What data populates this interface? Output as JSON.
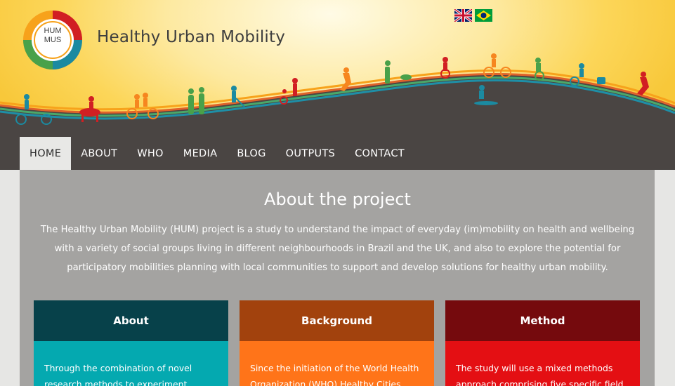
{
  "header": {
    "logo_text_line1": "HUM",
    "logo_text_line2": "MUS",
    "site_title": "Healthy Urban Mobility",
    "languages": [
      {
        "name": "English",
        "icon": "uk-flag-icon"
      },
      {
        "name": "Portuguese",
        "icon": "brazil-flag-icon"
      }
    ]
  },
  "nav": {
    "items": [
      "HOME",
      "ABOUT",
      "WHO",
      "MEDIA",
      "BLOG",
      "OUTPUTS",
      "CONTACT"
    ],
    "active": "HOME"
  },
  "main": {
    "title": "About the project",
    "intro": "The Healthy Urban Mobility (HUM) project is a study to understand the impact of everyday (im)mobility on health and wellbeing with a variety of social groups living in different neighbourhoods in Brazil and the UK, and also to explore the potential for participatory mobilities planning with local communities to support and develop solutions for healthy urban mobility.",
    "cards": [
      {
        "title": "About",
        "text": "Through the combination of novel research methods to experiment, assess"
      },
      {
        "title": "Background",
        "text": "Since the initiation of the World Health Organization (WHO) Healthy Cities"
      },
      {
        "title": "Method",
        "text": "The study will use a mixed methods approach comprising five specific field"
      }
    ]
  },
  "colors": {
    "banner_yellow": "#fcd659",
    "road_dark": "#4a4543",
    "nav_active_bg": "#e8e8e6",
    "panel_grey": "#a4a3a1",
    "about_head": "#07414a",
    "about_body": "#04a9b0",
    "background_head": "#a2420d",
    "background_body": "#ff7419",
    "method_head": "#750a0d",
    "method_body": "#e40f13"
  }
}
